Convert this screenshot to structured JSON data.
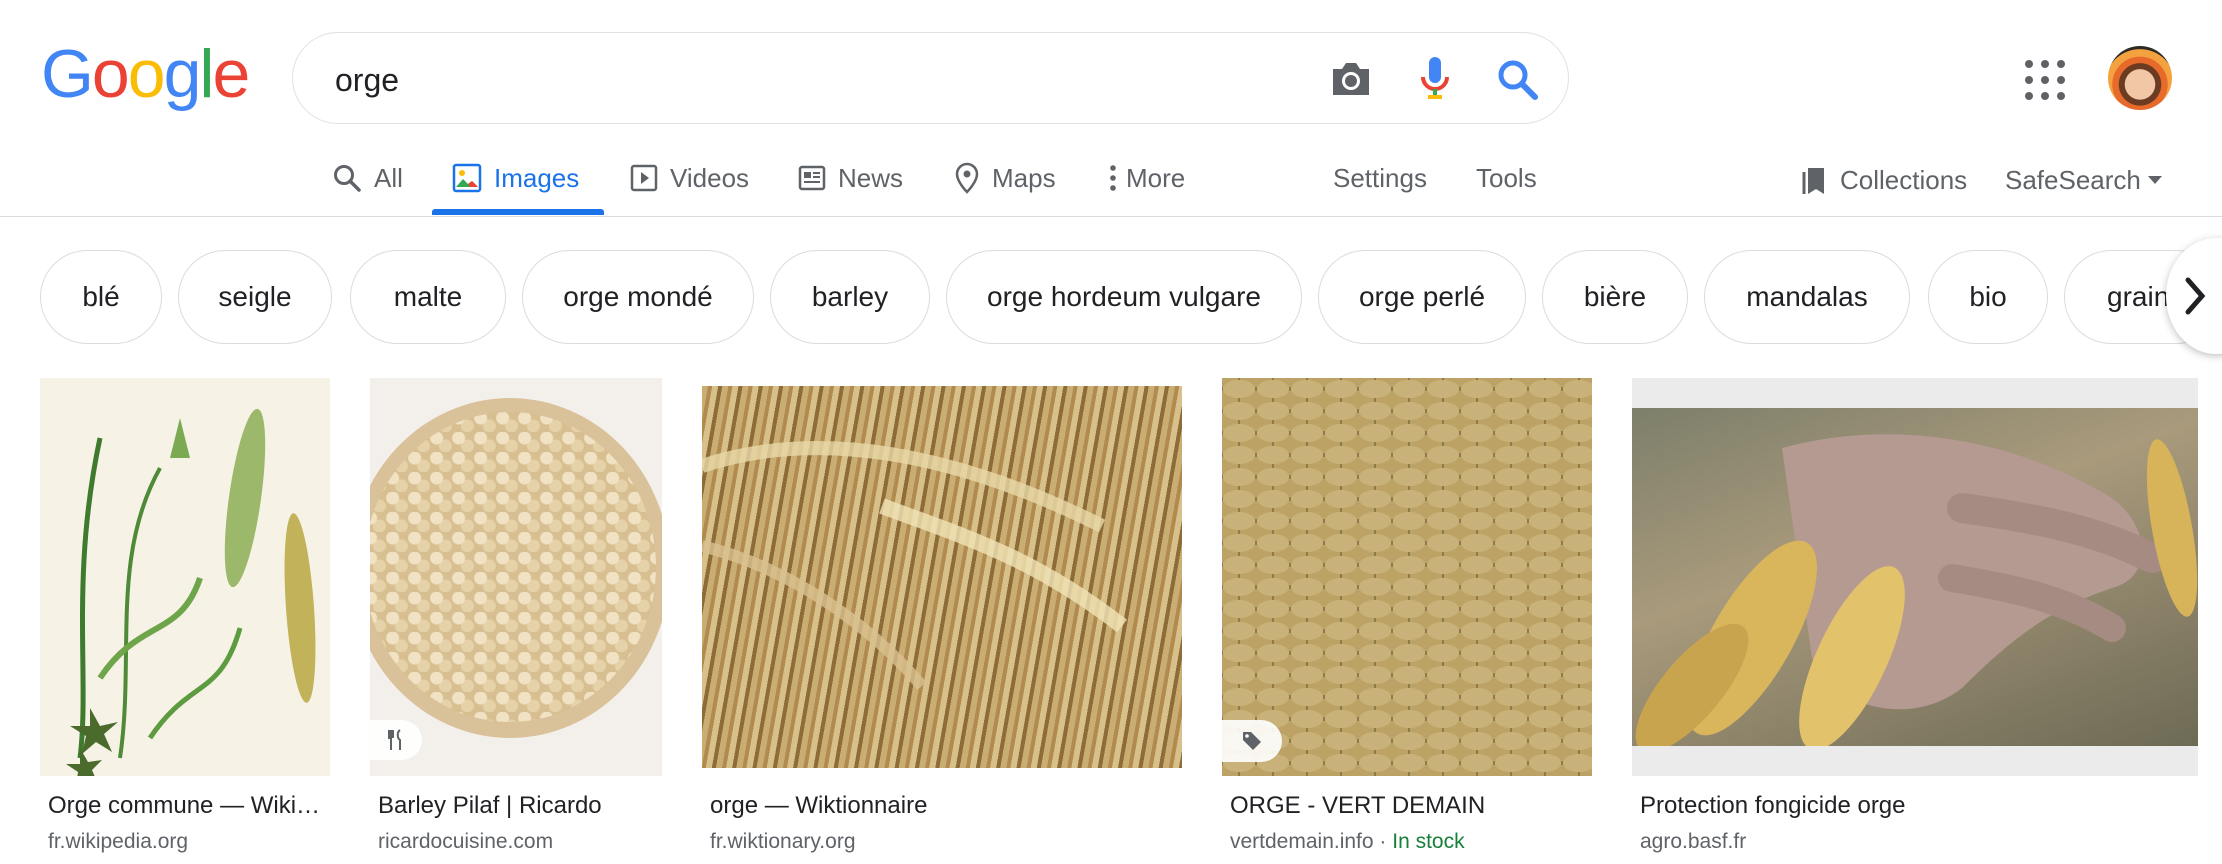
{
  "logo": {
    "letters": [
      "G",
      "o",
      "o",
      "g",
      "l",
      "e"
    ],
    "colors": [
      "#4285F4",
      "#EA4335",
      "#FBBC05",
      "#4285F4",
      "#34A853",
      "#EA4335"
    ]
  },
  "search": {
    "value": "orge",
    "icons": [
      "camera-icon",
      "mic-icon",
      "search-icon"
    ]
  },
  "header": {
    "apps_icon": "apps-grid-icon",
    "avatar": "account-avatar"
  },
  "tabs": [
    {
      "label": "All",
      "icon": "search-icon"
    },
    {
      "label": "Images",
      "icon": "image-icon",
      "active": true
    },
    {
      "label": "Videos",
      "icon": "play-icon"
    },
    {
      "label": "News",
      "icon": "news-icon"
    },
    {
      "label": "Maps",
      "icon": "pin-icon"
    },
    {
      "label": "More",
      "icon": "more-vert-icon"
    }
  ],
  "tools": {
    "settings": "Settings",
    "tools": "Tools",
    "collections": "Collections",
    "safesearch": "SafeSearch"
  },
  "chips": [
    "blé",
    "seigle",
    "malte",
    "orge mondé",
    "barley",
    "orge hordeum vulgare",
    "orge perlé",
    "bière",
    "mandalas",
    "bio",
    "grain"
  ],
  "results": [
    {
      "title": "Orge commune — Wiki…",
      "site": "fr.wikipedia.org",
      "stock": ""
    },
    {
      "title": "Barley Pilaf | Ricardo",
      "site": "ricardocuisine.com",
      "stock": ""
    },
    {
      "title": "orge — Wiktionnaire",
      "site": "fr.wiktionary.org",
      "stock": ""
    },
    {
      "title": "ORGE - VERT DEMAIN",
      "site": "vertdemain.info · ",
      "stock": "In stock"
    },
    {
      "title": "Protection fongicide orge",
      "site": "agro.basf.fr",
      "stock": ""
    }
  ],
  "colors": {
    "accent": "#1a73e8",
    "stock": "#188038",
    "muted": "#5f6368"
  }
}
